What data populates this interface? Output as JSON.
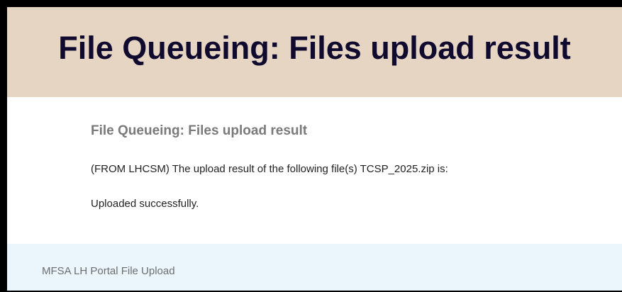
{
  "header": {
    "title": "File Queueing: Files upload result"
  },
  "content": {
    "heading": "File Queueing: Files upload result",
    "message": "(FROM LHCSM) The upload result of the following file(s) TCSP_2025.zip is:",
    "status": "Uploaded successfully."
  },
  "footer": {
    "text": "MFSA LH Portal File Upload"
  },
  "colors": {
    "header_background": "#e6d5c3",
    "header_text": "#0f0a2e",
    "footer_background": "#eaf6fc",
    "heading_text": "#7a7a7a"
  }
}
